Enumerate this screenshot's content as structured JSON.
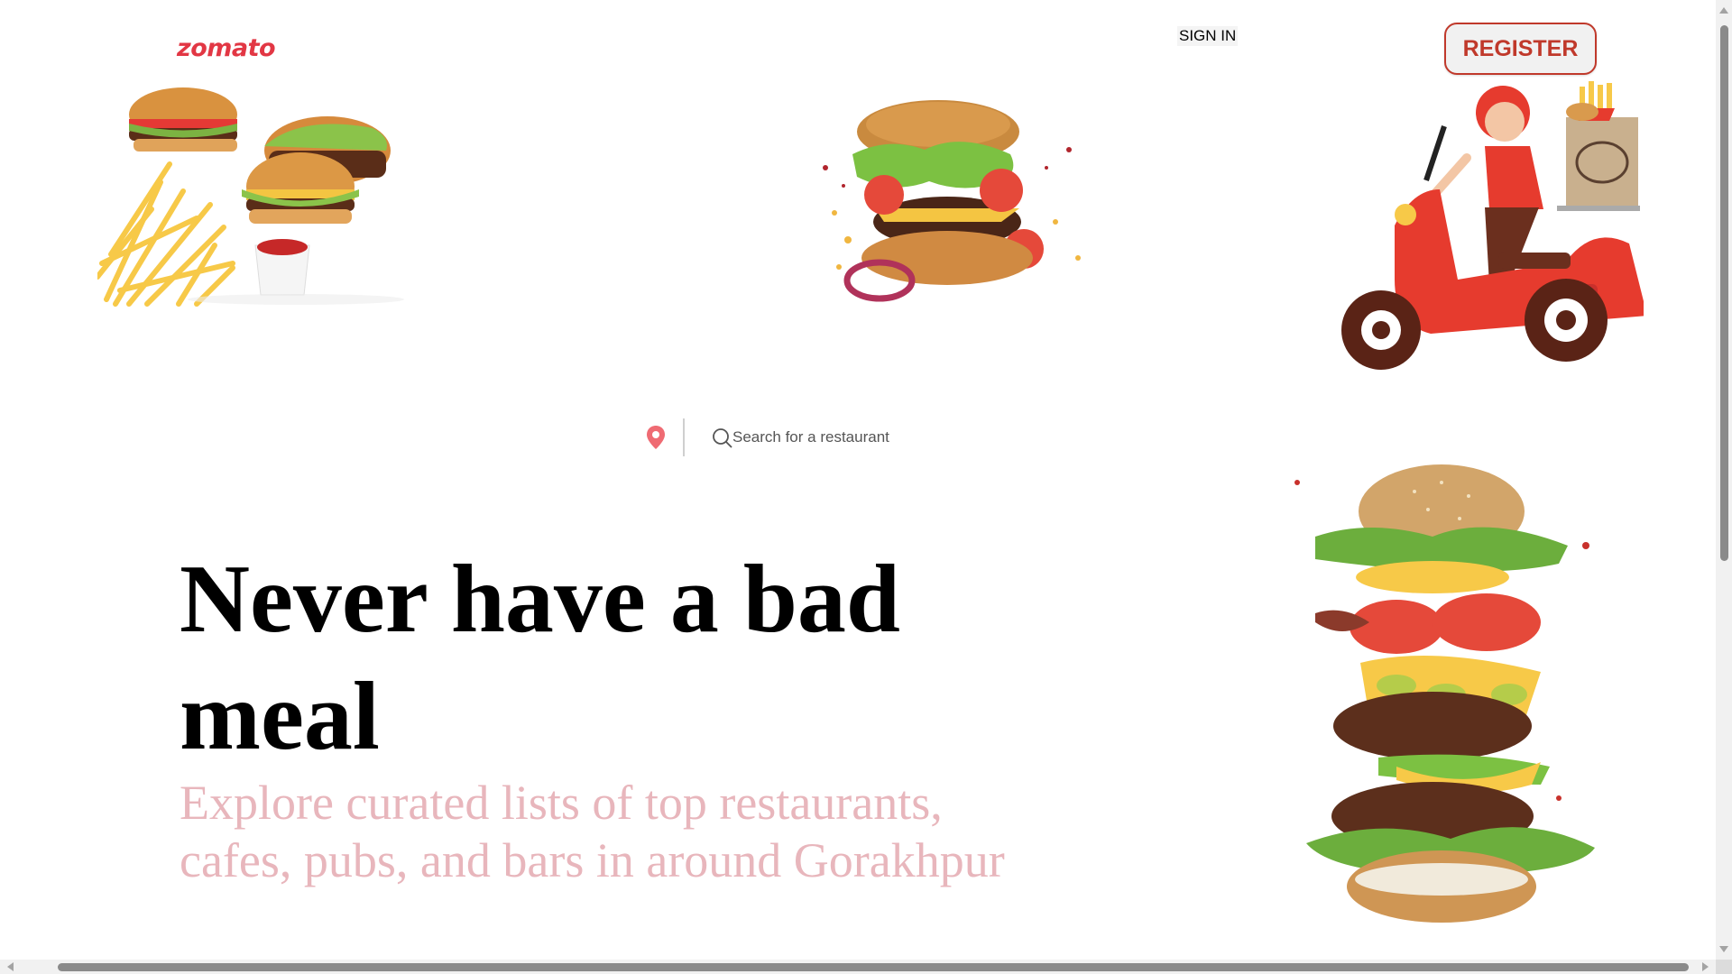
{
  "header": {
    "logo_text": "zomato",
    "signin_label": "SIGN IN",
    "register_label": "REGISTER"
  },
  "search": {
    "placeholder": "Search for a restaurant",
    "location_icon": "location-pin-icon",
    "search_icon": "search-icon"
  },
  "hero": {
    "headline": "Never have a bad meal",
    "tagline": "Explore curated lists of top restaurants, cafes, pubs, and bars in around Gorakhpur"
  },
  "colors": {
    "brand": "#e23744",
    "register_border": "#c0392b",
    "tagline": "#e8b6bc"
  }
}
